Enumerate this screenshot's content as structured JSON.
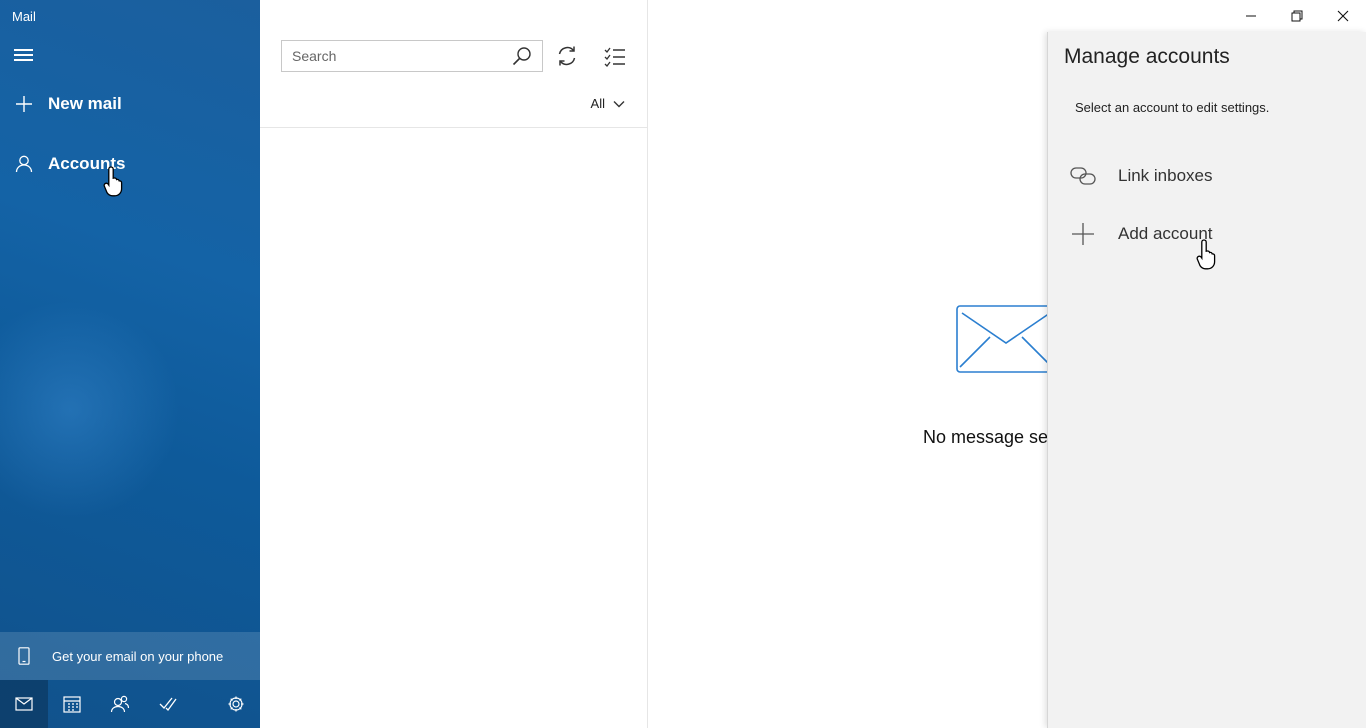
{
  "window": {
    "title": "Mail"
  },
  "nav": {
    "new_mail": "New mail",
    "accounts": "Accounts",
    "promo": "Get your email on your phone",
    "bottom_icons": [
      "mail-icon",
      "calendar-icon",
      "people-icon",
      "todo-icon",
      "settings-icon"
    ]
  },
  "list": {
    "search_placeholder": "Search",
    "filter": "All"
  },
  "reading": {
    "empty_text": "No message sel"
  },
  "flyout": {
    "title": "Manage accounts",
    "subtitle": "Select an account to edit settings.",
    "items": [
      {
        "label": "Link inboxes",
        "icon": "link-icon"
      },
      {
        "label": "Add account",
        "icon": "plus-icon"
      }
    ]
  },
  "colors": {
    "nav_blue": "#1463a6",
    "flyout_bg": "#f2f2f2",
    "accent": "#0e6ac4"
  }
}
